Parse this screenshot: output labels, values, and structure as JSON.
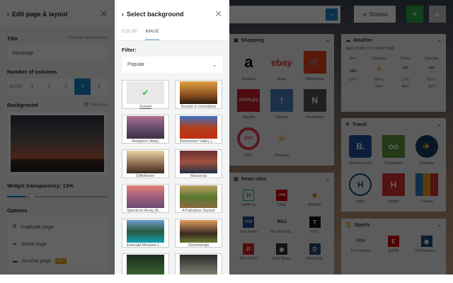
{
  "left_panel": {
    "title": "Edit page & layout",
    "title_label": "Title",
    "change_description": "Change description",
    "title_value": "Startpage",
    "columns_label": "Number of columns",
    "columns": [
      "AUTO",
      "1",
      "2",
      "3",
      "4",
      "5"
    ],
    "selected_column": "4",
    "background_label": "Background",
    "remove_label": "Remove",
    "transparency_label": "Widget transparency: 13%",
    "transparency_value": 13,
    "options_label": "Options",
    "options": [
      "Duplicate page",
      "Share page",
      "Archive page"
    ],
    "archive_badge": "New"
  },
  "mid_panel": {
    "title": "Select background",
    "tabs": [
      "COLOR",
      "IMAGE"
    ],
    "active_tab": "IMAGE",
    "filter_label": "Filter:",
    "filter_value": "Popular",
    "images": [
      "Sunset",
      "Sunset in mountains",
      "Bergamo (Italy)",
      "Monument Valley (USA)",
      "Eiffeltower",
      "Manarola",
      "Spectrum Array (Aust...",
      "A Fabulous Sunset",
      "Emerald Moraine Lake",
      "Stonehenge"
    ],
    "selected_image": "Sunset"
  },
  "dashboard": {
    "shared_label": "Shared",
    "shopping": {
      "title": "Shopping",
      "items": [
        "Amazon",
        "Ebay",
        "AliExpress",
        "Staples",
        "Zappos",
        "Nordstrom",
        "QVC",
        "Walmart"
      ]
    },
    "news": {
      "title": "News sites",
      "items": [
        "HuffPost",
        "CNN",
        "MSNBC",
        "Fox News",
        "The Wall St...",
        "NYT",
        "POLITICO",
        "CBS News",
        "DRUDGE"
      ]
    },
    "weather": {
      "title": "Weather",
      "location": "NEW YORK CITY, NEW YORK",
      "days": [
        {
          "day": "Now",
          "temp": "53°F",
          "low": ""
        },
        {
          "day": "Thursday",
          "temp": "60°F |",
          "low": "48°F"
        },
        {
          "day": "Friday",
          "temp": "71°F |",
          "low": "48°F"
        },
        {
          "day": "Saturday",
          "temp": "60°F |",
          "low": "53°F"
        }
      ]
    },
    "travel": {
      "title": "Travel",
      "items": [
        "Booking.com",
        "Tripadvisor",
        "Expedia",
        "Hilton",
        "Hotels",
        "Trivago"
      ]
    },
    "sports": {
      "title": "Sports",
      "items": [
        "Fox Sports",
        "ESPN",
        "CBSSports...."
      ]
    }
  }
}
